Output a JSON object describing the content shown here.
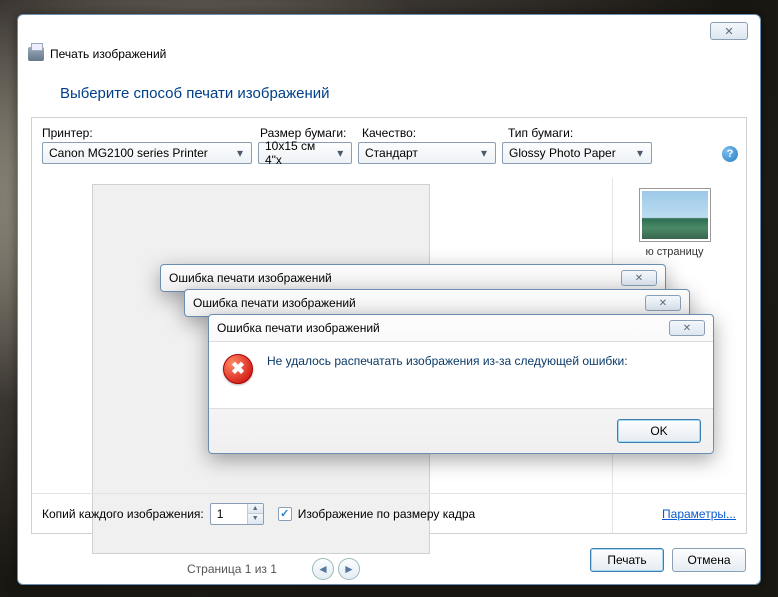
{
  "window": {
    "title": "Печать изображений"
  },
  "header": {
    "heading": "Выберите способ печати изображений"
  },
  "labels": {
    "printer": "Принтер:",
    "paper_size": "Размер бумаги:",
    "quality": "Качество:",
    "paper_type": "Тип бумаги:"
  },
  "combos": {
    "printer": "Canon MG2100 series Printer",
    "paper_size": "10x15 см 4\"x",
    "quality": "Стандарт",
    "paper_type": "Glossy Photo Paper"
  },
  "thumb": {
    "caption": "ю страницу"
  },
  "pager": {
    "label": "Страница 1 из 1",
    "prev": "◄",
    "next": "►"
  },
  "bottom": {
    "copies_label": "Копий каждого изображения:",
    "copies_value": "1",
    "fit_label": "Изображение по размеру кадра",
    "fit_checked": true,
    "params_link": "Параметры..."
  },
  "buttons": {
    "print": "Печать",
    "cancel": "Отмена",
    "ok": "OK",
    "close_glyph": "✕"
  },
  "error_dialogs": {
    "title": "Ошибка печати изображений",
    "message": "Не удалось распечатать изображения из-за следующей ошибки:"
  }
}
